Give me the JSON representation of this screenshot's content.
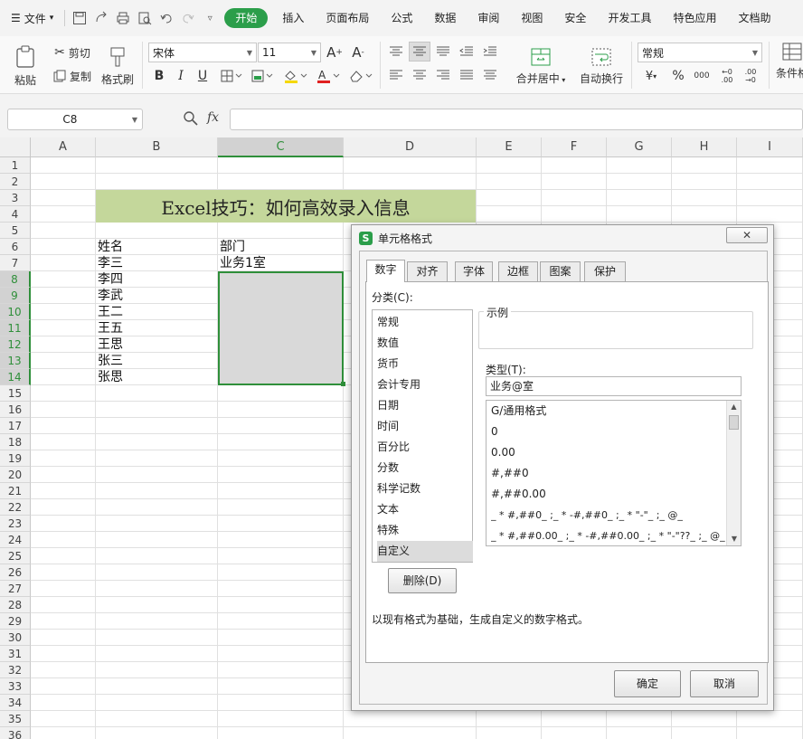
{
  "menubar": {
    "file_label": "文件",
    "tabs": [
      "开始",
      "插入",
      "页面布局",
      "公式",
      "数据",
      "审阅",
      "视图",
      "安全",
      "开发工具",
      "特色应用",
      "文档助"
    ]
  },
  "ribbon": {
    "paste": "粘贴",
    "cut": "剪切",
    "copy": "复制",
    "format_painter": "格式刷",
    "font_name": "宋体",
    "font_size": "11",
    "merge_center": "合并居中",
    "wrap_text": "自动换行",
    "number_format": "常规",
    "conditional": "条件格"
  },
  "formula_bar": {
    "name_box": "C8",
    "fx": "fx",
    "formula": ""
  },
  "sheet": {
    "columns": [
      "A",
      "B",
      "C",
      "D",
      "E",
      "F",
      "G",
      "H",
      "I"
    ],
    "rows": [
      "1",
      "2",
      "3",
      "4",
      "5",
      "6",
      "7",
      "8",
      "9",
      "10",
      "11",
      "12",
      "13",
      "14",
      "15",
      "16",
      "17",
      "18",
      "19",
      "20",
      "21",
      "22",
      "23",
      "24",
      "25",
      "26",
      "27",
      "28",
      "29",
      "30",
      "31",
      "32",
      "33",
      "34",
      "35",
      "36"
    ],
    "title": "Excel技巧：如何高效录入信息",
    "header_name": "姓名",
    "header_dept": "部门",
    "names": [
      "李三",
      "李四",
      "李武",
      "王二",
      "王五",
      "王思",
      "张三",
      "张思"
    ],
    "dept_c7": "业务1室"
  },
  "dialog": {
    "title": "单元格格式",
    "tabs": [
      "数字",
      "对齐",
      "字体",
      "边框",
      "图案",
      "保护"
    ],
    "category_label": "分类(C):",
    "categories": [
      "常规",
      "数值",
      "货币",
      "会计专用",
      "日期",
      "时间",
      "百分比",
      "分数",
      "科学记数",
      "文本",
      "特殊",
      "自定义"
    ],
    "selected_category": "自定义",
    "sample_label": "示例",
    "sample_value": "",
    "type_label": "类型(T):",
    "type_value": "业务@室",
    "formats": [
      "G/通用格式",
      "0",
      "0.00",
      "#,##0",
      "#,##0.00",
      "_ * #,##0_ ;_ * -#,##0_ ;_ * \"-\"_ ;_ @_",
      "_ * #,##0.00_ ;_ * -#,##0.00_ ;_ * \"-\"??_ ;_ @_"
    ],
    "delete_button": "删除(D)",
    "description": "以现有格式为基础，生成自定义的数字格式。",
    "ok_button": "确定",
    "cancel_button": "取消"
  },
  "colors": {
    "accent_green": "#2b9e4a",
    "title_bg": "#c4d79b",
    "selection_border": "#2f8f3a",
    "selection_fill": "#d9d9d9"
  }
}
